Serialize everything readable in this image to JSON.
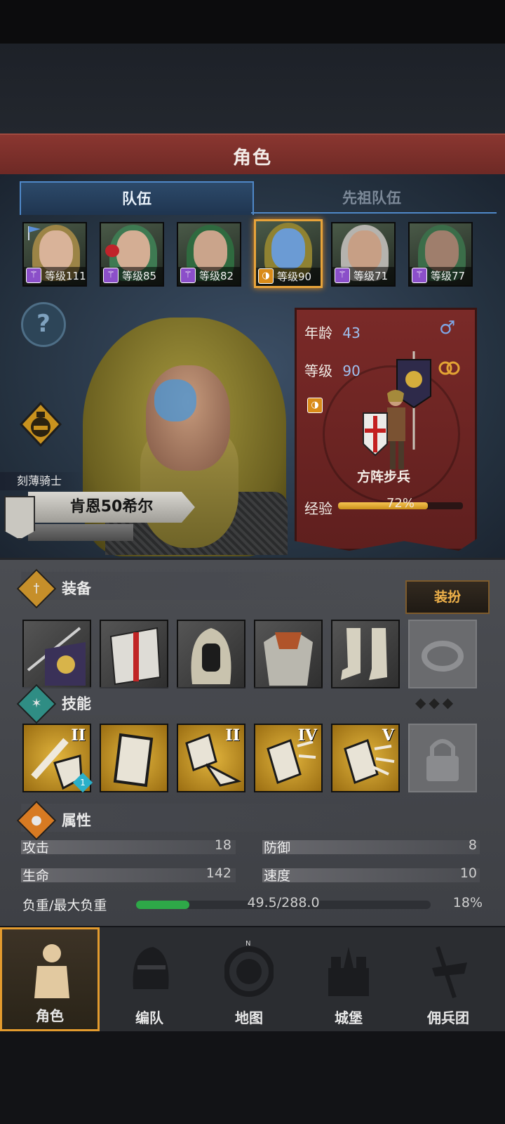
{
  "header": {
    "title": "角色"
  },
  "tabs": [
    {
      "label": "队伍",
      "active": true
    },
    {
      "label": "先祖队伍",
      "active": false
    }
  ],
  "party": [
    {
      "level": "等级111",
      "class_icon": "staff-icon"
    },
    {
      "level": "等级85",
      "class_icon": "staff-icon"
    },
    {
      "level": "等级82",
      "class_icon": "staff-icon"
    },
    {
      "level": "等级90",
      "class_icon": "shield-icon",
      "selected": true
    },
    {
      "level": "等级71",
      "class_icon": "staff-icon"
    },
    {
      "level": "等级77",
      "class_icon": "staff-icon"
    }
  ],
  "hero": {
    "title": "刻薄骑士",
    "name": "肯恩50希尔"
  },
  "info": {
    "age_label": "年龄",
    "age": "43",
    "gender_symbol": "♂",
    "level_label": "等级",
    "level": "90",
    "unit_name": "方阵步兵",
    "xp_label": "经验",
    "xp_text": "72%",
    "xp_fraction": 0.72
  },
  "equipment": {
    "title": "装备",
    "dress_button": "装扮"
  },
  "skills": {
    "title": "技能",
    "ranks": [
      "II",
      "",
      "II",
      "IV",
      "V"
    ],
    "badge": "1"
  },
  "attributes": {
    "title": "属性",
    "attack_label": "攻击",
    "attack": "18",
    "defense_label": "防御",
    "defense": "8",
    "hp_label": "生命",
    "hp": "142",
    "speed_label": "速度",
    "speed": "10",
    "load_label": "负重/最大负重",
    "load": "49.5/288.0",
    "load_pct": "18%",
    "load_fraction": 0.18
  },
  "nav": [
    {
      "label": "角色",
      "active": true
    },
    {
      "label": "编队"
    },
    {
      "label": "地图"
    },
    {
      "label": "城堡"
    },
    {
      "label": "佣兵团"
    }
  ],
  "colors": {
    "accent": "#e39b2e",
    "tab_blue": "#4f88c8",
    "header_red": "#7a2c28"
  }
}
